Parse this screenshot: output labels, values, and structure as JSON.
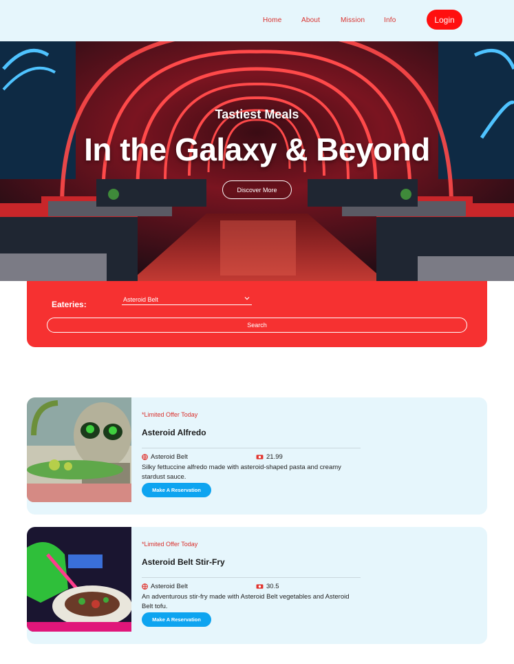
{
  "nav": {
    "items": [
      {
        "label": "Home"
      },
      {
        "label": "About"
      },
      {
        "label": "Mission"
      },
      {
        "label": "Info"
      }
    ],
    "login_label": "Login"
  },
  "hero": {
    "subtitle": "Tastiest Meals",
    "title": "In the Galaxy & Beyond",
    "button_label": "Discover More"
  },
  "search": {
    "label": "Eateries:",
    "selected_eatery": "Asteroid Belt",
    "button_label": "Search"
  },
  "menu_items": [
    {
      "offer": "*Limited Offer Today",
      "title": "Asteroid Alfredo",
      "location": "Asteroid Belt",
      "price": "21.99",
      "description": "Silky fettuccine alfredo made with asteroid-shaped pasta and creamy stardust sauce.",
      "button_label": "Make A Reservation"
    },
    {
      "offer": "*Limited Offer Today",
      "title": "Asteroid Belt Stir-Fry",
      "location": "Asteroid Belt",
      "price": "30.5",
      "description": "An adventurous stir-fry made with Asteroid Belt vegetables and Asteroid Belt tofu.",
      "button_label": "Make A Reservation"
    }
  ],
  "colors": {
    "header_bg": "#e6f6fc",
    "accent_red": "#f63131",
    "login_red": "#ff0f0f",
    "button_blue": "#0ea4f0",
    "card_bg": "#e6f6fc"
  },
  "icons": {
    "location": "globe-icon",
    "price": "ticket-icon",
    "dropdown": "chevron-down-icon"
  }
}
